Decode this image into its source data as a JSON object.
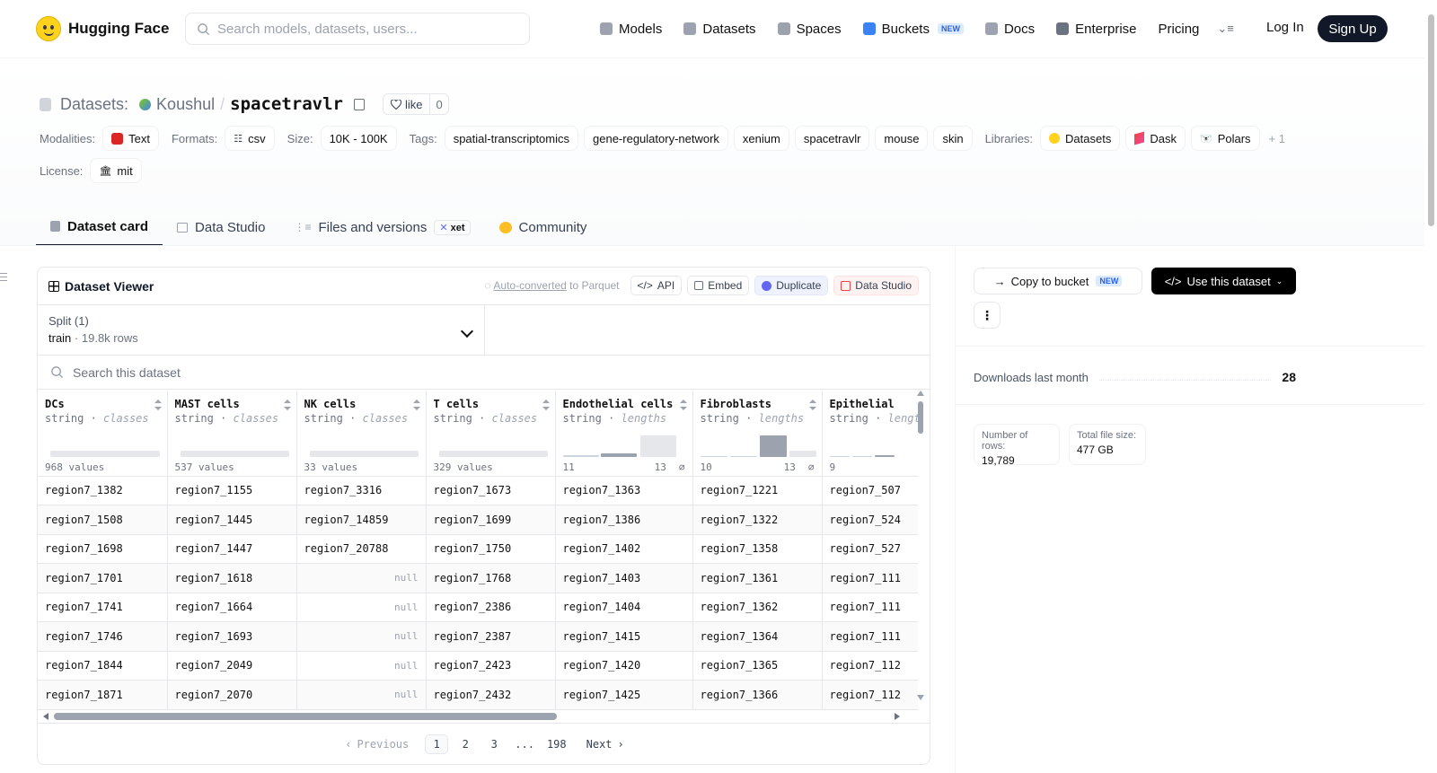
{
  "nav": {
    "brand": "Hugging Face",
    "search_placeholder": "Search models, datasets, users...",
    "items": [
      {
        "label": "Models",
        "icon": "cube-icon",
        "color": "#9ca3af"
      },
      {
        "label": "Datasets",
        "icon": "database-icon",
        "color": "#9ca3af"
      },
      {
        "label": "Spaces",
        "icon": "grid-icon",
        "color": "#9ca3af"
      },
      {
        "label": "Buckets",
        "icon": "bucket-icon",
        "color": "#3b82f6",
        "badge": "NEW"
      },
      {
        "label": "Docs",
        "icon": "book-icon",
        "color": "#9ca3af"
      },
      {
        "label": "Enterprise",
        "icon": "enterprise-icon",
        "color": "#6b7280"
      },
      {
        "label": "Pricing"
      }
    ],
    "login": "Log In",
    "signup": "Sign Up"
  },
  "repo": {
    "type_label": "Datasets:",
    "owner": "Koushul",
    "name": "spacetravlr",
    "like_label": "like",
    "like_count": "0"
  },
  "tags": {
    "modalities_key": "Modalities:",
    "modalities": [
      "Text"
    ],
    "formats_key": "Formats:",
    "formats": [
      "csv"
    ],
    "size_key": "Size:",
    "size": "10K - 100K",
    "tags_key": "Tags:",
    "tags": [
      "spatial-transcriptomics",
      "gene-regulatory-network",
      "xenium",
      "spacetravlr",
      "mouse",
      "skin"
    ],
    "libraries_key": "Libraries:",
    "libraries": [
      "Datasets",
      "Dask",
      "Polars"
    ],
    "libraries_more": "+ 1",
    "license_key": "License:",
    "license": "mit"
  },
  "tabs": [
    {
      "label": "Dataset card",
      "active": true
    },
    {
      "label": "Data Studio"
    },
    {
      "label": "Files and versions",
      "badge": "xet"
    },
    {
      "label": "Community"
    }
  ],
  "viewer": {
    "title": "Dataset Viewer",
    "auto_converted": "Auto-converted",
    "to_parquet": "to Parquet",
    "actions": [
      "API",
      "Embed",
      "Duplicate",
      "Data Studio"
    ],
    "split_label": "Split (1)",
    "split_name": "train",
    "split_rows": "19.8k rows",
    "search_placeholder": "Search this dataset",
    "columns": [
      {
        "name": "DCs",
        "type": "string",
        "kind": "classes",
        "summary": "968 values"
      },
      {
        "name": "MAST cells",
        "type": "string",
        "kind": "classes",
        "summary": "537 values"
      },
      {
        "name": "NK cells",
        "type": "string",
        "kind": "classes",
        "summary": "33 values"
      },
      {
        "name": "T cells",
        "type": "string",
        "kind": "classes",
        "summary": "329 values"
      },
      {
        "name": "Endothelial cells",
        "type": "string",
        "kind": "lengths",
        "min": "11",
        "max": "13",
        "null_sym": "⌀"
      },
      {
        "name": "Fibroblasts",
        "type": "string",
        "kind": "lengths",
        "min": "10",
        "max": "13",
        "null_sym": "⌀"
      },
      {
        "name": "Epithelial",
        "type": "string",
        "kind": "lengths",
        "min": "9",
        "max": "",
        "null_sym": ""
      }
    ],
    "rows": [
      [
        "region7_1382",
        "region7_1155",
        "region7_3316",
        "region7_1673",
        "region7_1363",
        "region7_1221",
        "region7_507"
      ],
      [
        "region7_1508",
        "region7_1445",
        "region7_14859",
        "region7_1699",
        "region7_1386",
        "region7_1322",
        "region7_524"
      ],
      [
        "region7_1698",
        "region7_1447",
        "region7_20788",
        "region7_1750",
        "region7_1402",
        "region7_1358",
        "region7_527"
      ],
      [
        "region7_1701",
        "region7_1618",
        "null",
        "region7_1768",
        "region7_1403",
        "region7_1361",
        "region7_111"
      ],
      [
        "region7_1741",
        "region7_1664",
        "null",
        "region7_2386",
        "region7_1404",
        "region7_1362",
        "region7_111"
      ],
      [
        "region7_1746",
        "region7_1693",
        "null",
        "region7_2387",
        "region7_1415",
        "region7_1364",
        "region7_111"
      ],
      [
        "region7_1844",
        "region7_2049",
        "null",
        "region7_2423",
        "region7_1420",
        "region7_1365",
        "region7_112"
      ],
      [
        "region7_1871",
        "region7_2070",
        "null",
        "region7_2432",
        "region7_1425",
        "region7_1366",
        "region7_112"
      ]
    ],
    "pager": {
      "prev": "Previous",
      "pages": [
        "1",
        "2",
        "3",
        "...",
        "198"
      ],
      "current": "1",
      "next": "Next"
    }
  },
  "sidebar": {
    "copy_bucket": "Copy to bucket",
    "copy_badge": "NEW",
    "use_dataset": "Use this dataset",
    "downloads_label": "Downloads last month",
    "downloads_value": "28",
    "rows_label": "Number of rows:",
    "rows_value": "19,789",
    "size_label": "Total file size:",
    "size_value": "477 GB"
  }
}
